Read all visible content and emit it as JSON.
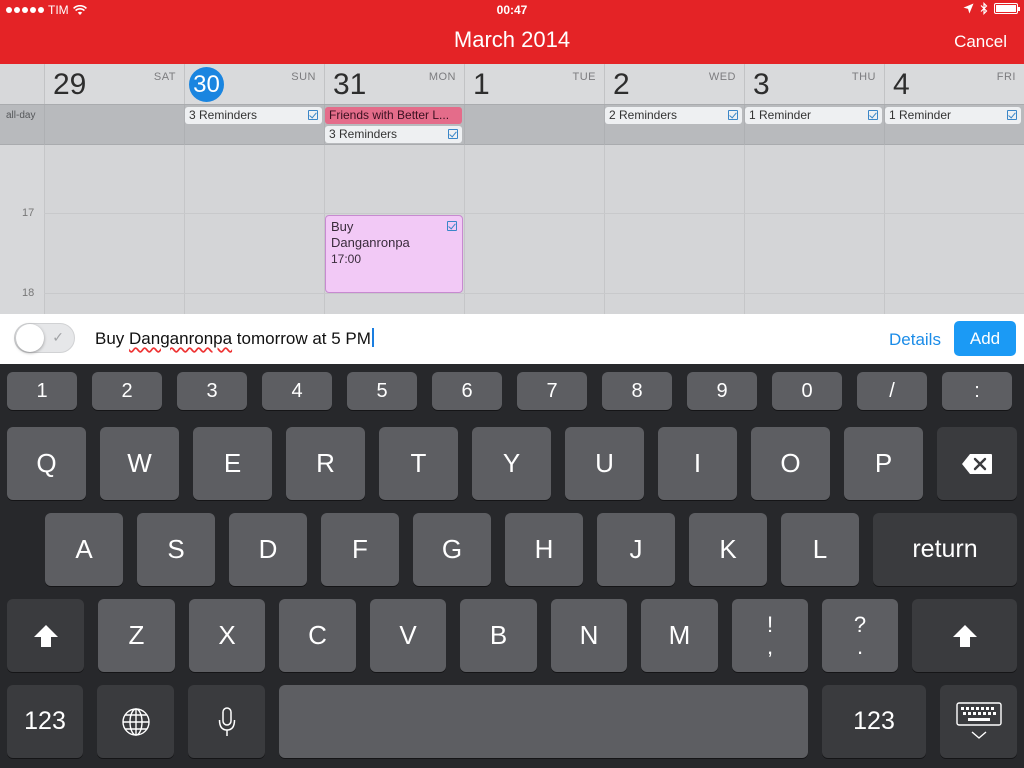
{
  "status_bar": {
    "carrier": "TIM",
    "time": "00:47"
  },
  "header": {
    "title": "March 2014",
    "cancel_label": "Cancel"
  },
  "calendar": {
    "allday_label": "all-day",
    "days": [
      {
        "num": "29",
        "label": "SAT",
        "today": false
      },
      {
        "num": "30",
        "label": "SUN",
        "today": true
      },
      {
        "num": "31",
        "label": "MON",
        "today": false
      },
      {
        "num": "1",
        "label": "TUE",
        "today": false
      },
      {
        "num": "2",
        "label": "WED",
        "today": false
      },
      {
        "num": "3",
        "label": "THU",
        "today": false
      },
      {
        "num": "4",
        "label": "FRI",
        "today": false
      }
    ],
    "allday_chips": {
      "sun": "3 Reminders",
      "mon_1": "Friends with Better L...",
      "mon_2": "3 Reminders",
      "wed": "2 Reminders",
      "thu": "1 Reminder",
      "fri": "1 Reminder"
    },
    "hours": [
      "17",
      "18"
    ],
    "event": {
      "title_line1": "Buy",
      "title_line2": "Danganronpa",
      "time": "17:00"
    }
  },
  "input_bar": {
    "text_before": "Buy ",
    "text_misspelled": "Danganronpa",
    "text_after": " tomorrow at 5 PM",
    "details_label": "Details",
    "add_label": "Add"
  },
  "keyboard": {
    "numbers": [
      "1",
      "2",
      "3",
      "4",
      "5",
      "6",
      "7",
      "8",
      "9",
      "0",
      "/",
      ":"
    ],
    "row1": [
      "Q",
      "W",
      "E",
      "R",
      "T",
      "Y",
      "U",
      "I",
      "O",
      "P"
    ],
    "row2": [
      "A",
      "S",
      "D",
      "F",
      "G",
      "H",
      "J",
      "K",
      "L"
    ],
    "row3": [
      "Z",
      "X",
      "C",
      "V",
      "B",
      "N",
      "M"
    ],
    "punct1": {
      "top": "!",
      "bottom": ","
    },
    "punct2": {
      "top": "?",
      "bottom": "."
    },
    "return_label": "return",
    "numeric_label": "123"
  }
}
